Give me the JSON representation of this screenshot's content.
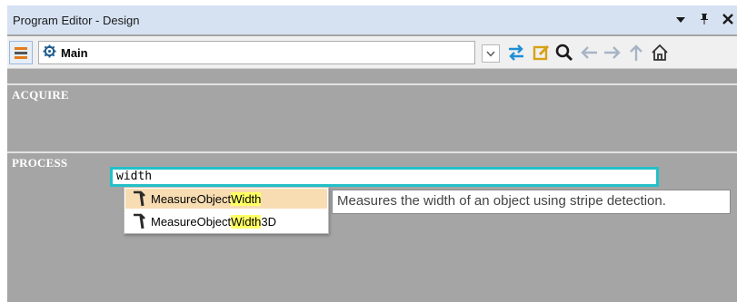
{
  "window": {
    "title": "Program Editor - Design",
    "title_controls": {
      "dropdown": "▾",
      "pin": "ȧ",
      "close": "✕"
    }
  },
  "toolbar": {
    "routine_name": "Main",
    "dropdown_glyph": "∨",
    "icons": [
      "menu-icon",
      "gear-icon",
      "swap-icon",
      "edit-icon",
      "search-icon",
      "back-arrow-icon",
      "forward-arrow-icon",
      "up-arrow-icon",
      "home-icon"
    ]
  },
  "sections": {
    "acquire": "ACQUIRE",
    "process": "PROCESS"
  },
  "search": {
    "value": "width"
  },
  "autocomplete": {
    "items": [
      {
        "prefix": "MeasureObject",
        "match": "Width",
        "suffix": "",
        "selected": true
      },
      {
        "prefix": "MeasureObject",
        "match": "Width",
        "suffix": "3D",
        "selected": false
      }
    ],
    "tooltip": "Measures the width of an object using stripe detection."
  },
  "colors": {
    "canvas": "#a5a5a5",
    "titlebar": "#d6e2f2",
    "input_border": "#24c0c8",
    "selected_item": "#f8ddb3",
    "match_highlight": "#ffff64"
  }
}
